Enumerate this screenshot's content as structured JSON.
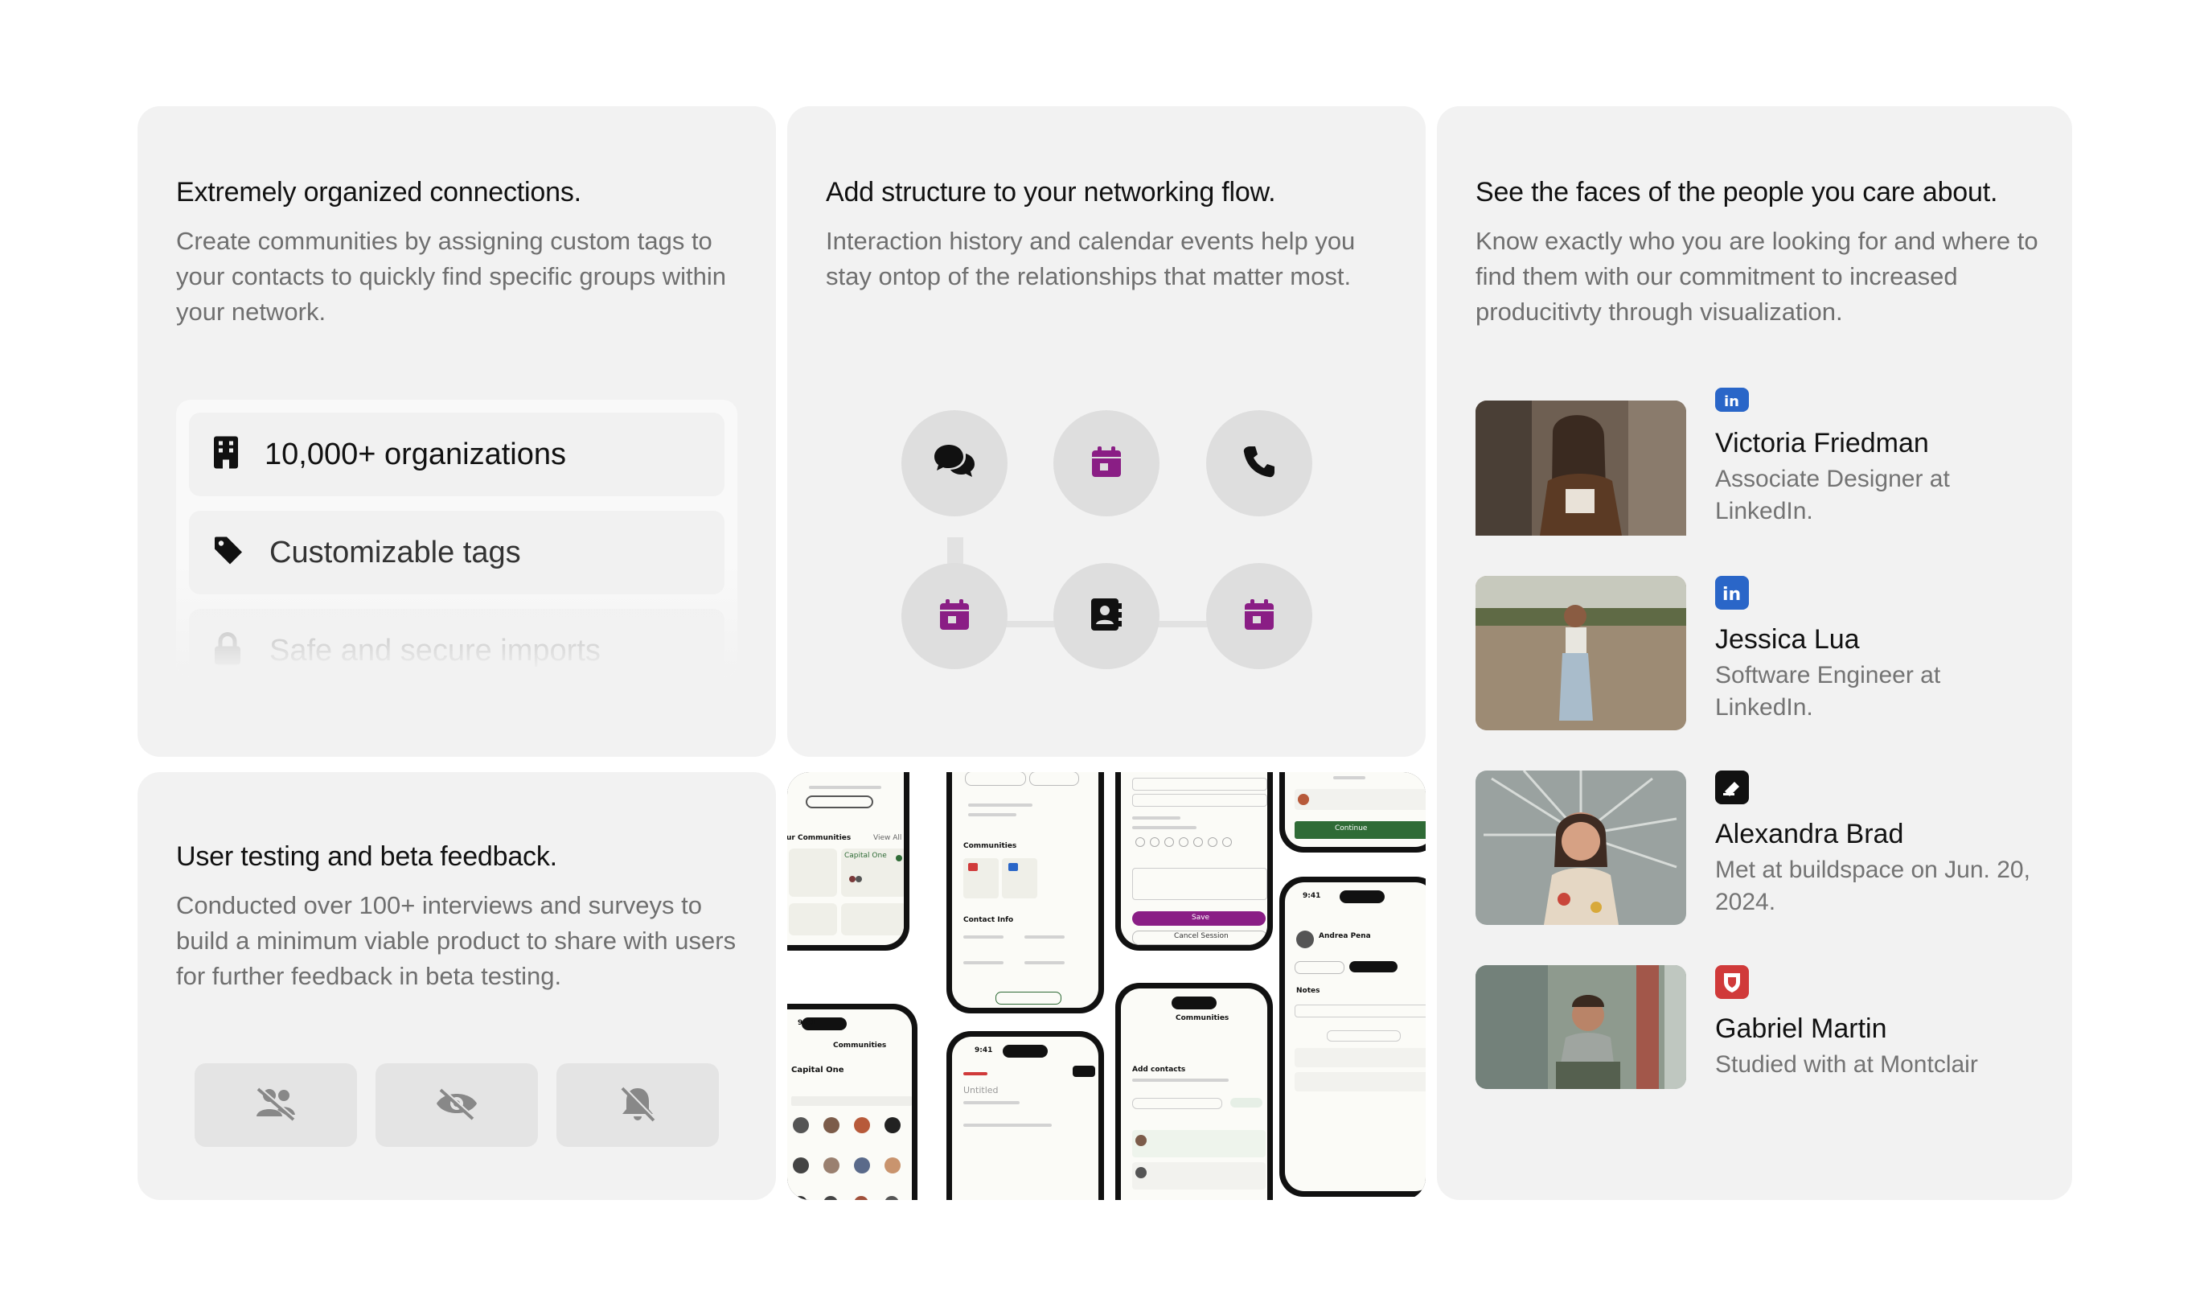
{
  "colors": {
    "card_bg": "#f2f2f2",
    "accent_purple": "#8a1e85",
    "linkedin_blue": "#2a66c8",
    "app_green": "#2f6b36",
    "red_badge": "#d03a3a"
  },
  "organized": {
    "title": "Extremely organized connections.",
    "description": "Create communities by assigning custom tags to your contacts to quickly find specific groups within your network.",
    "items": [
      {
        "icon": "building-icon",
        "label": "10,000+ organizations"
      },
      {
        "icon": "tag-icon",
        "label": "Customizable tags"
      },
      {
        "icon": "lock-icon",
        "label": "Safe and secure imports"
      }
    ]
  },
  "structure": {
    "title": "Add structure to your networking flow.",
    "description": "Interaction history and calendar events help you stay ontop of the relationships that matter most.",
    "nodes": [
      "chat-icon",
      "calendar-icon",
      "phone-icon",
      "calendar-icon",
      "contact-book-icon",
      "calendar-icon"
    ]
  },
  "faces": {
    "title": "See the faces of the people you care about.",
    "description": "Know exactly who you are looking for and where to find them with our commitment to increased producitivty through visualization.",
    "people": [
      {
        "name": "Victoria Friedman",
        "description": "Associate Designer at LinkedIn.",
        "badge": "linkedin-icon"
      },
      {
        "name": "Jessica Lua",
        "description": "Software Engineer at LinkedIn.",
        "badge": "linkedin-icon"
      },
      {
        "name": "Alexandra Brad",
        "description": "Met at buildspace on Jun. 20, 2024.",
        "badge": "buildspace-icon"
      },
      {
        "name": "Gabriel Martin",
        "description": "Studied with at Montclair",
        "badge": "university-shield-icon"
      }
    ]
  },
  "testing": {
    "title": "User testing and beta feedback.",
    "description": "Conducted over 100+ interviews and surveys to build a minimum viable product to share with users for further feedback in beta testing.",
    "buttons": [
      "users-slash-icon",
      "eye-slash-icon",
      "bell-slash-icon"
    ]
  },
  "mockups": {
    "labels": {
      "communities_header": "ur Communities",
      "view_all": "View All",
      "capital_one": "Capital One",
      "communities": "Communities",
      "contact_info": "Contact Info",
      "save": "Save",
      "cancel_session": "Cancel Session",
      "continue": "Continue",
      "add_contacts": "Add contacts",
      "untitled": "Untitled",
      "notes": "Notes",
      "andrea_pena": "Andrea Pena",
      "time": "9:41"
    }
  }
}
